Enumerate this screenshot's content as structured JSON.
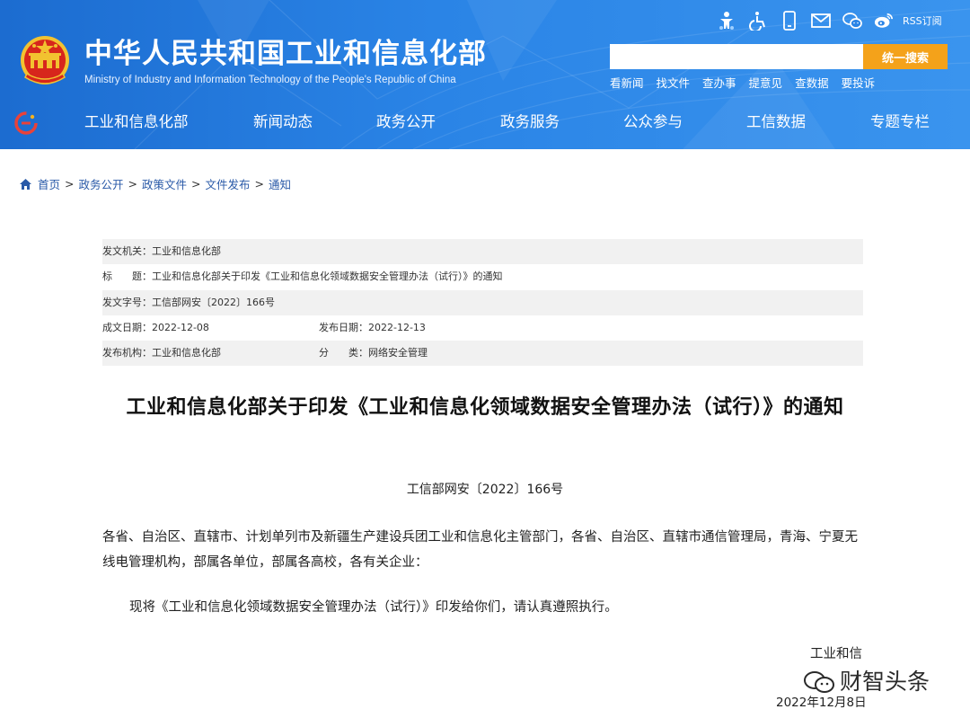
{
  "header": {
    "title": "中华人民共和国工业和信息化部",
    "subtitle": "Ministry of Industry and Information Technology of the People's Republic of China",
    "top_icons": [
      "accessibility-child-icon",
      "wheelchair-icon",
      "mobile-phone-icon",
      "mail-icon",
      "wechat-icon",
      "weibo-icon"
    ],
    "rss_label": "RSS订阅",
    "search": {
      "placeholder": "",
      "button_label": "统一搜索"
    },
    "quick_links": [
      "看新闻",
      "找文件",
      "查办事",
      "提意见",
      "查数据",
      "要投诉"
    ]
  },
  "nav": {
    "items": [
      "工业和信息化部",
      "新闻动态",
      "政务公开",
      "政务服务",
      "公众参与",
      "工信数据",
      "专题专栏"
    ]
  },
  "breadcrumb": [
    "首页",
    "政务公开",
    "政策文件",
    "文件发布",
    "通知"
  ],
  "meta": {
    "issuer": "发文机关：工业和信息化部",
    "title": "标　　题：工业和信息化部关于印发《工业和信息化领域数据安全管理办法（试行）》的通知",
    "doc_no": "发文字号：工信部网安〔2022〕166号",
    "created": "成文日期：2022-12-08",
    "published": "发布日期：2022-12-13",
    "org": "发布机构：工业和信息化部",
    "category": "分　　类：网络安全管理"
  },
  "article": {
    "title": "工业和信息化部关于印发《工业和信息化领域数据安全管理办法（试行）》的通知",
    "doc_no": "工信部网安〔2022〕166号",
    "recipients": "各省、自治区、直辖市、计划单列市及新疆生产建设兵团工业和信息化主管部门，各省、自治区、直辖市通信管理局，青海、宁夏无线电管理机构，部属各单位，部属各高校，各有关企业：",
    "body": "现将《工业和信息化领域数据安全管理办法（试行）》印发给你们，请认真遵照执行。",
    "sign_org": "工业和信",
    "sign_date": "2022年12月8日"
  },
  "watermark": {
    "text": "财智头条",
    "icon": "wechat-official-account-icon"
  },
  "colors": {
    "header_blue": "#2a84e6",
    "search_orange": "#f4a21a",
    "link_blue": "#2a5aa8",
    "meta_shade": "#f1f1f1"
  }
}
